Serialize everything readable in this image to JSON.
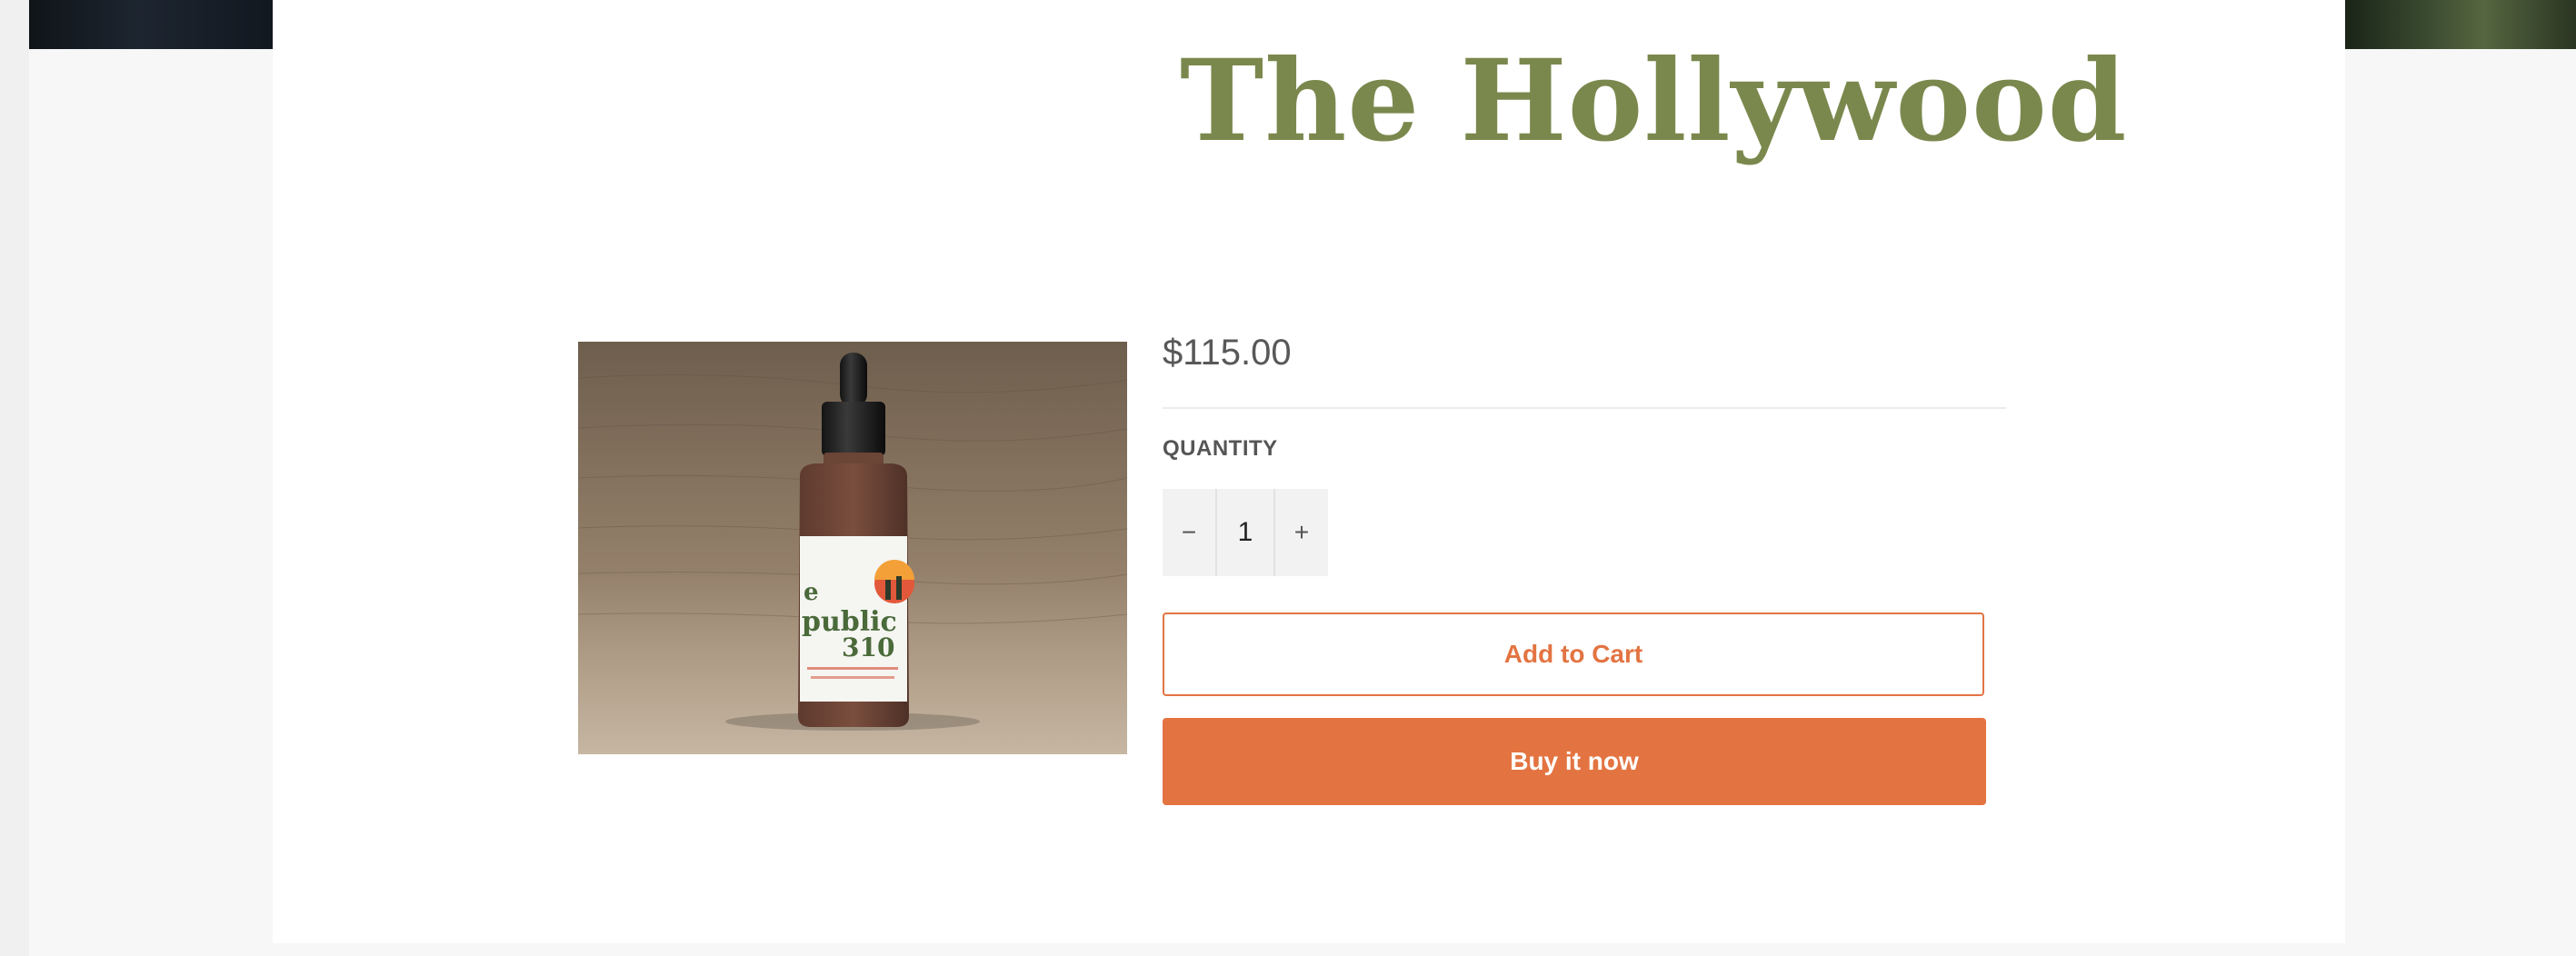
{
  "product": {
    "title": "The Hollywood",
    "price": "$115.00",
    "image_alt": "Bottle of The Republic 310 CBD oil tincture",
    "label_text": {
      "line1": "e",
      "line2": "public",
      "line3": "310"
    }
  },
  "quantity": {
    "label": "QUANTITY",
    "value": "1",
    "decrement_symbol": "−",
    "increment_symbol": "+"
  },
  "actions": {
    "add_to_cart": "Add to Cart",
    "buy_now": "Buy it now"
  },
  "colors": {
    "title": "#7b884d",
    "accent": "#e37442",
    "price": "#585858"
  }
}
